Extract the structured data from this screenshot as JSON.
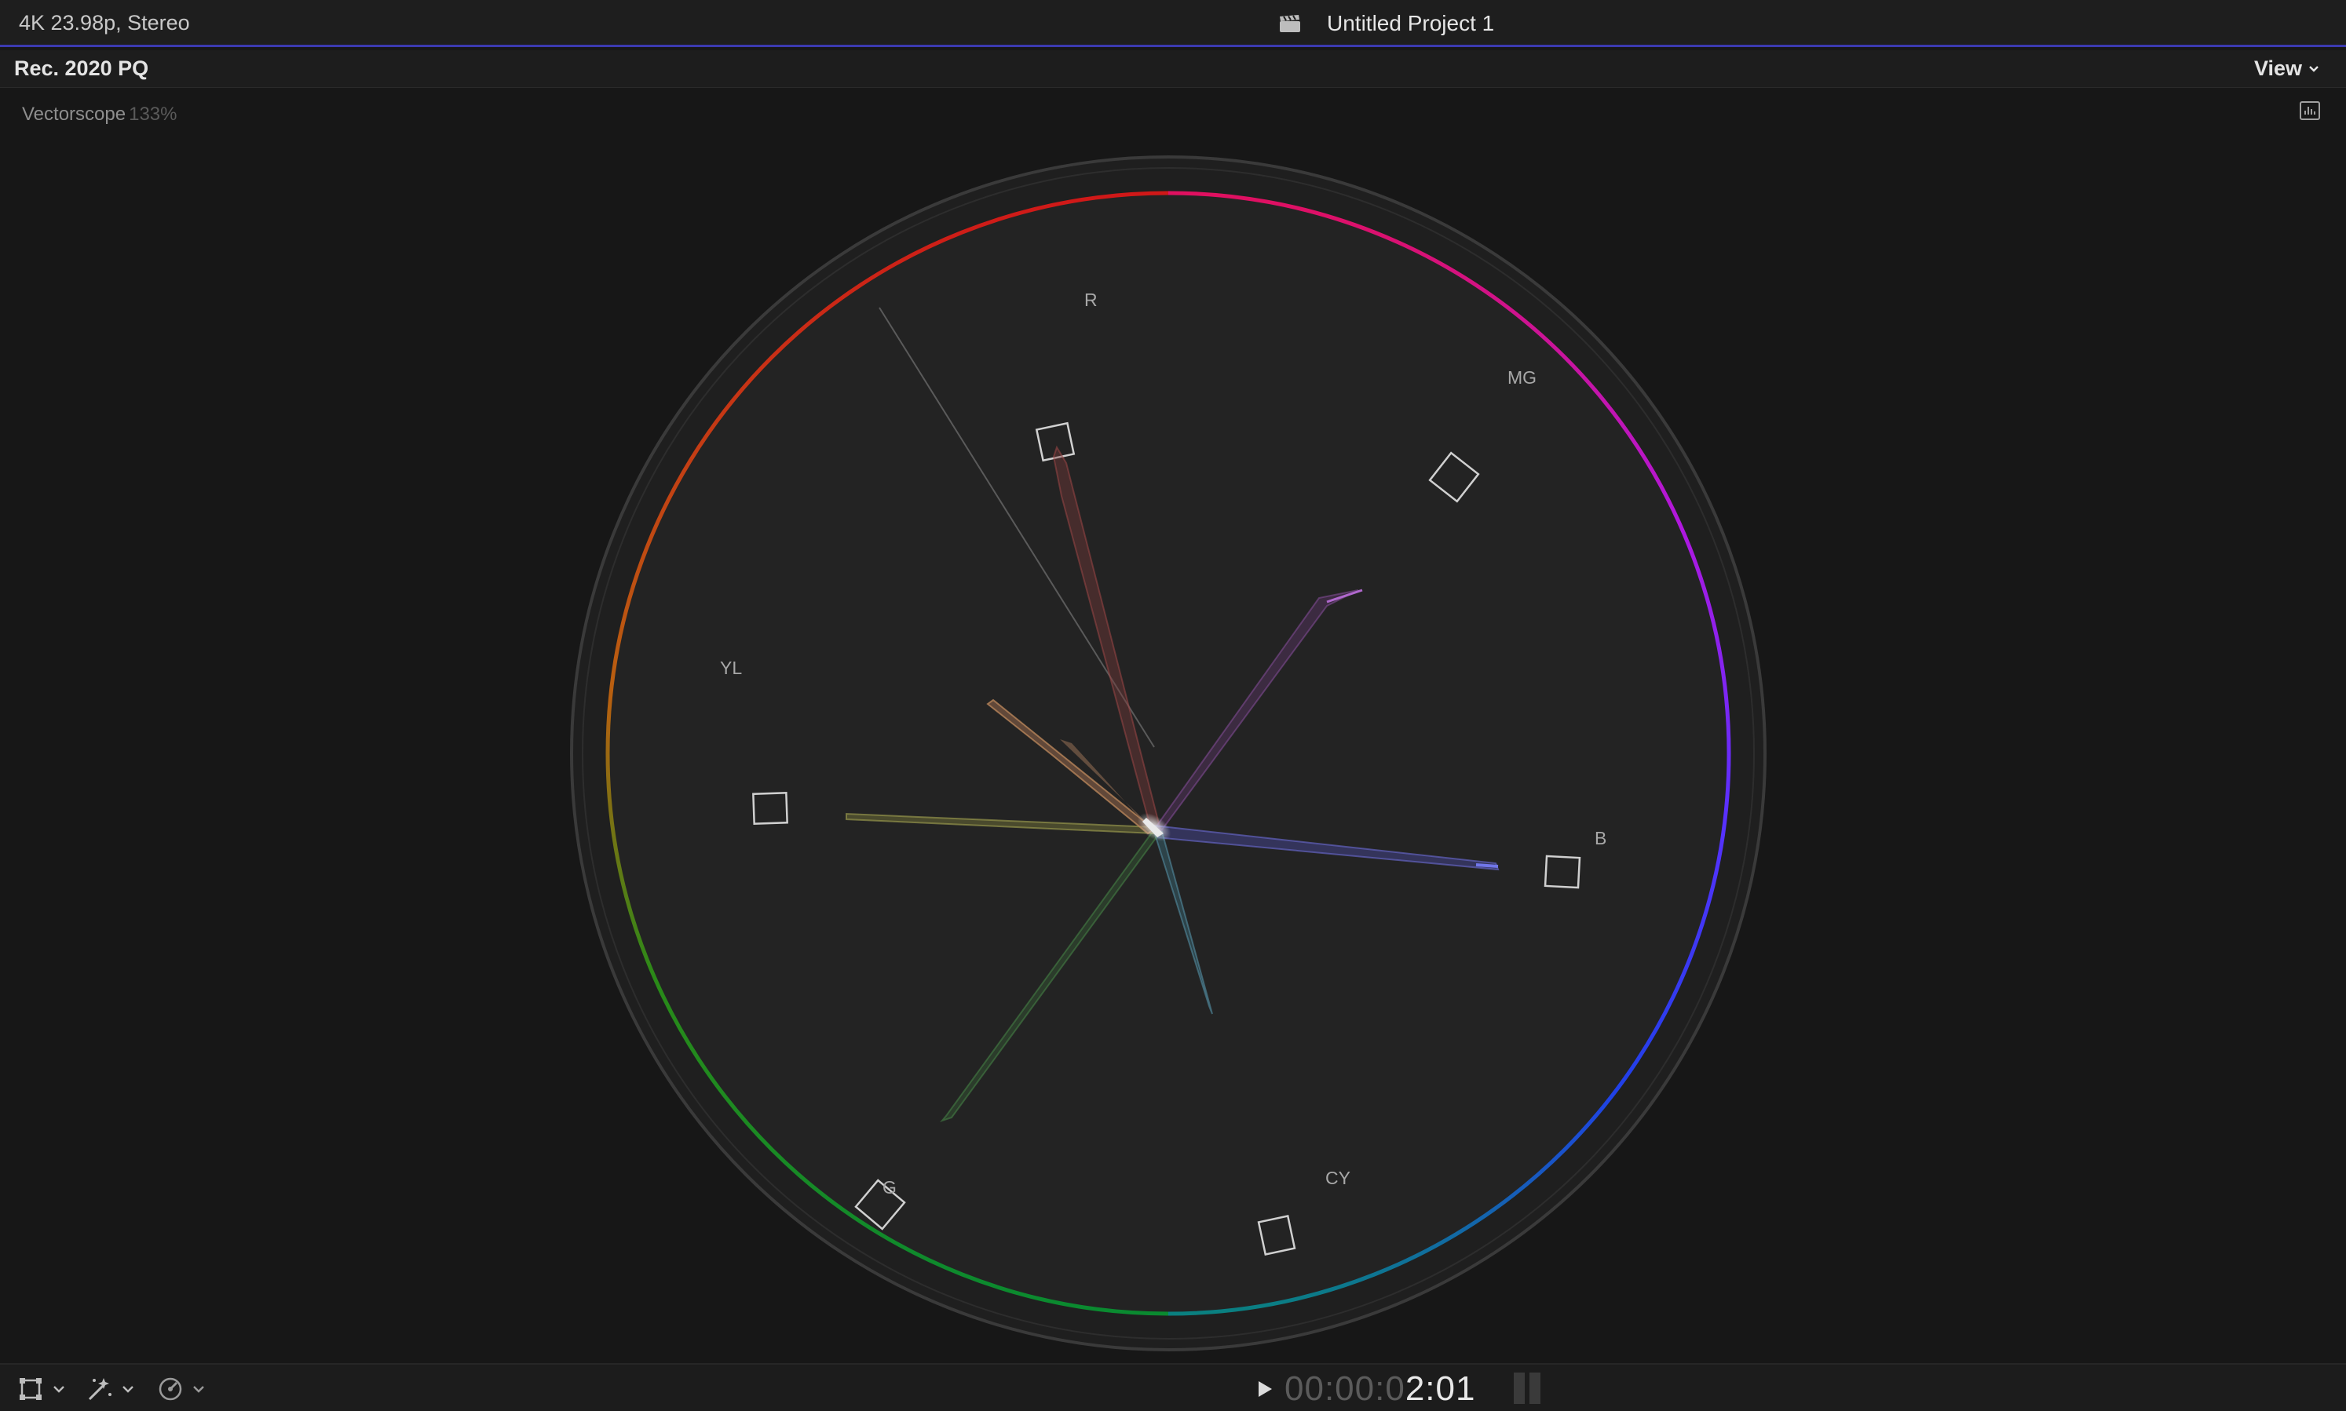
{
  "header": {
    "format": "4K 23.98p, Stereo",
    "project_title": "Untitled Project 1",
    "clapper_icon": "clapperboard-icon"
  },
  "subheader": {
    "color_space": "Rec. 2020 PQ",
    "view_label": "View"
  },
  "scope": {
    "name": "Vectorscope",
    "zoom": "133%",
    "targets": [
      {
        "label": "R"
      },
      {
        "label": "MG"
      },
      {
        "label": "B"
      },
      {
        "label": "CY"
      },
      {
        "label": "G"
      },
      {
        "label": "YL"
      }
    ],
    "settings_icon": "scope-settings-icon"
  },
  "footer": {
    "timecode_dim": "00:00:0",
    "timecode_bright": "2:01",
    "tools": [
      "transform-icon",
      "enhance-wand-icon",
      "speed-retime-icon"
    ]
  },
  "colors": {
    "accent": "#3b3ab0",
    "background": "#171717",
    "scope_disc": "#202020"
  }
}
